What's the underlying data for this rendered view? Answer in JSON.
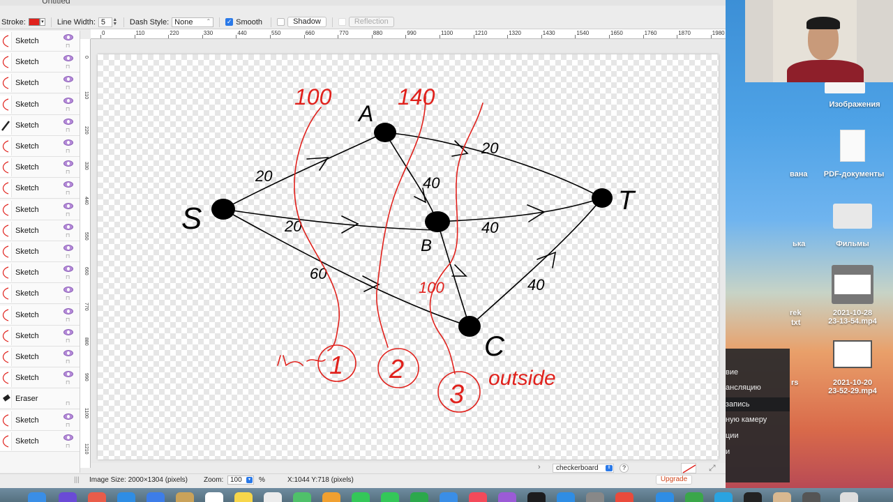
{
  "window": {
    "title": "Untitled"
  },
  "options_bar": {
    "stroke_label": "Stroke:",
    "stroke_color": "#e0211c",
    "line_width_label": "Line Width:",
    "line_width_value": "5",
    "dash_style_label": "Dash Style:",
    "dash_style_value": "None",
    "smooth_label": "Smooth",
    "smooth_checked": true,
    "shadow_label": "Shadow",
    "reflection_label": "Reflection"
  },
  "layers": [
    {
      "name": "Sketch"
    },
    {
      "name": "Sketch"
    },
    {
      "name": "Sketch"
    },
    {
      "name": "Sketch"
    },
    {
      "name": "Sketch"
    },
    {
      "name": "Sketch"
    },
    {
      "name": "Sketch"
    },
    {
      "name": "Sketch"
    },
    {
      "name": "Sketch"
    },
    {
      "name": "Sketch"
    },
    {
      "name": "Sketch"
    },
    {
      "name": "Sketch"
    },
    {
      "name": "Sketch"
    },
    {
      "name": "Sketch"
    },
    {
      "name": "Sketch"
    },
    {
      "name": "Sketch"
    },
    {
      "name": "Sketch"
    },
    {
      "name": "Eraser"
    },
    {
      "name": "Sketch"
    },
    {
      "name": "Sketch"
    }
  ],
  "ruler": {
    "horizontal": [
      "0",
      "110",
      "220",
      "330",
      "440",
      "550",
      "660",
      "770",
      "880",
      "990",
      "1100",
      "1210",
      "1320",
      "1430",
      "1540",
      "1650",
      "1760",
      "1870",
      "1980"
    ],
    "vertical": [
      "0",
      "110",
      "220",
      "330",
      "440",
      "550",
      "660",
      "770",
      "880",
      "990",
      "1100",
      "1210"
    ]
  },
  "drawing": {
    "nodes": [
      "S",
      "A",
      "B",
      "C",
      "T"
    ],
    "capacities": [
      "20",
      "20",
      "60",
      "40",
      "20",
      "40",
      "40"
    ],
    "cut_caps": [
      "100",
      "140",
      "100"
    ],
    "cut_numbers": [
      "1",
      "2",
      "3"
    ],
    "outside_word": "outside"
  },
  "canvas_footer": {
    "background_mode": "checkerboard",
    "help": "?"
  },
  "status": {
    "image_size": "Image Size: 2000×1304 (pixels)",
    "zoom_label": "Zoom:",
    "zoom_value": "100",
    "zoom_unit": "%",
    "cursor_pos": "X:1044 Y:718 (pixels)",
    "upgrade_label": "Upgrade"
  },
  "desktop": {
    "items": [
      {
        "label": "Изображения"
      },
      {
        "label": "PDF-документы"
      },
      {
        "label": "Фильмы"
      },
      {
        "label": "2021-10-28\n23-13-54.mp4"
      },
      {
        "label": "2021-10-20\n23-52-29.mp4"
      }
    ],
    "cut_labels": [
      "вана",
      "ька",
      "rek",
      "txt",
      "rs"
    ],
    "menu_items": [
      "вие",
      "ансляцию",
      "запись",
      "ную камеру",
      "ции",
      "и"
    ]
  }
}
